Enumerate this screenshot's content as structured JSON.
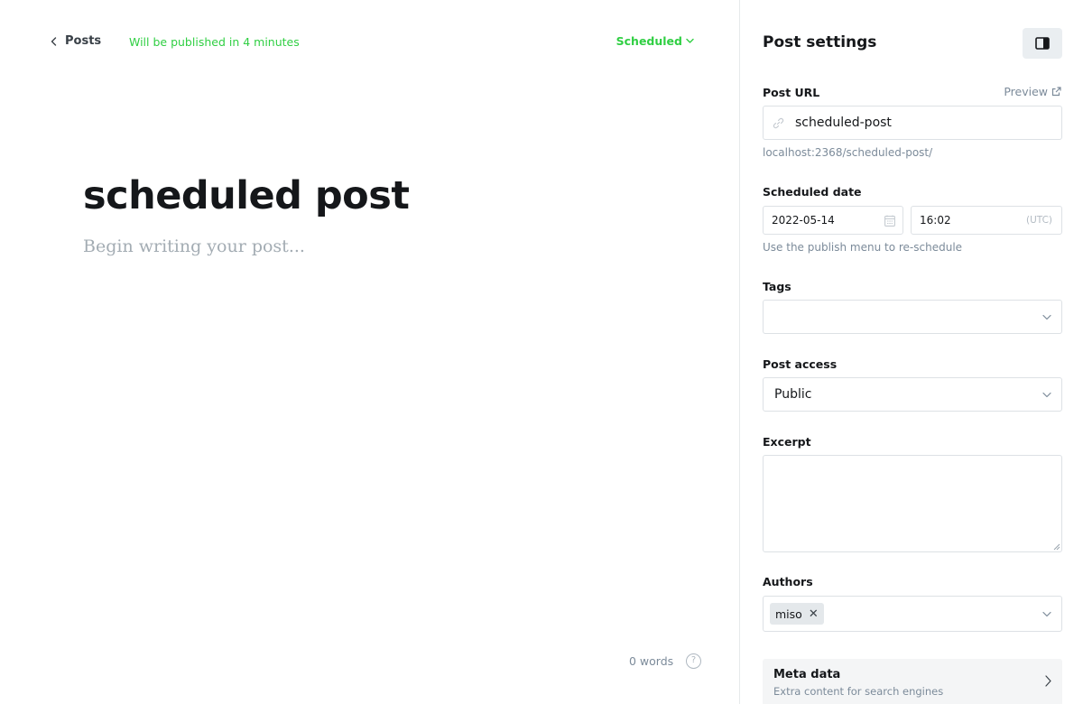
{
  "header": {
    "back_label": "Posts",
    "publish_note": "Will be published in 4 minutes",
    "status_label": "Scheduled"
  },
  "editor": {
    "title": "scheduled post",
    "body_placeholder": "Begin writing your post...",
    "word_count": "0 words",
    "help_label": "?"
  },
  "sidebar": {
    "title": "Post settings",
    "post_url": {
      "label": "Post URL",
      "preview_label": "Preview",
      "value": "scheduled-post",
      "hint": "localhost:2368/scheduled-post/"
    },
    "scheduled_date": {
      "label": "Scheduled date",
      "date": "2022-05-14",
      "time": "16:02",
      "timezone": "(UTC)",
      "hint": "Use the publish menu to re-schedule"
    },
    "tags": {
      "label": "Tags",
      "value": ""
    },
    "post_access": {
      "label": "Post access",
      "value": "Public"
    },
    "excerpt": {
      "label": "Excerpt",
      "value": ""
    },
    "authors": {
      "label": "Authors",
      "items": [
        "miso"
      ],
      "remove_glyph": "✕"
    },
    "meta_data": {
      "title": "Meta data",
      "subtitle": "Extra content for search engines"
    }
  },
  "colors": {
    "accent_green": "#30cf43",
    "text_primary": "#15171a",
    "text_muted": "#7c8b9a",
    "border": "#dde1e5"
  }
}
